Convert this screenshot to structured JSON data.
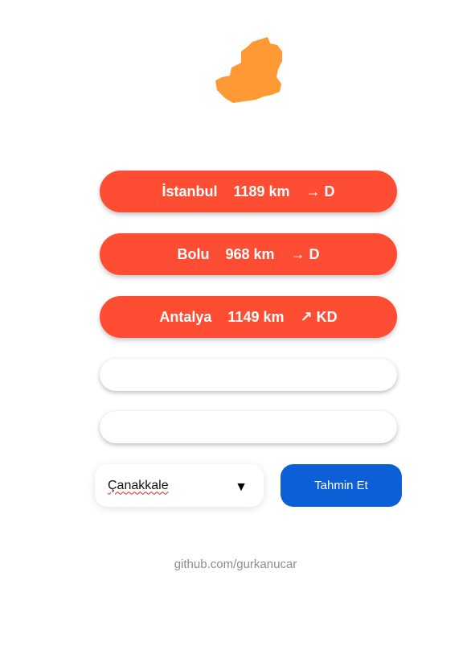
{
  "colors": {
    "map_fill": "#ff9933",
    "guess_pill": "#ff4d33",
    "submit_button": "#0d5fd8",
    "footer_text": "#8c8c8c"
  },
  "map": {
    "icon": "province-silhouette"
  },
  "guesses": [
    {
      "city": "İstanbul",
      "distance": "1189 km",
      "direction": "→ D"
    },
    {
      "city": "Bolu",
      "distance": "968 km",
      "direction": "→ D"
    },
    {
      "city": "Antalya",
      "distance": "1149 km",
      "direction": "↗ KD"
    }
  ],
  "city_select": {
    "value": "Çanakkale",
    "arrow_icon": "▼"
  },
  "submit": {
    "label": "Tahmin Et"
  },
  "footer": {
    "link_text": "github.com/gurkanucar"
  }
}
